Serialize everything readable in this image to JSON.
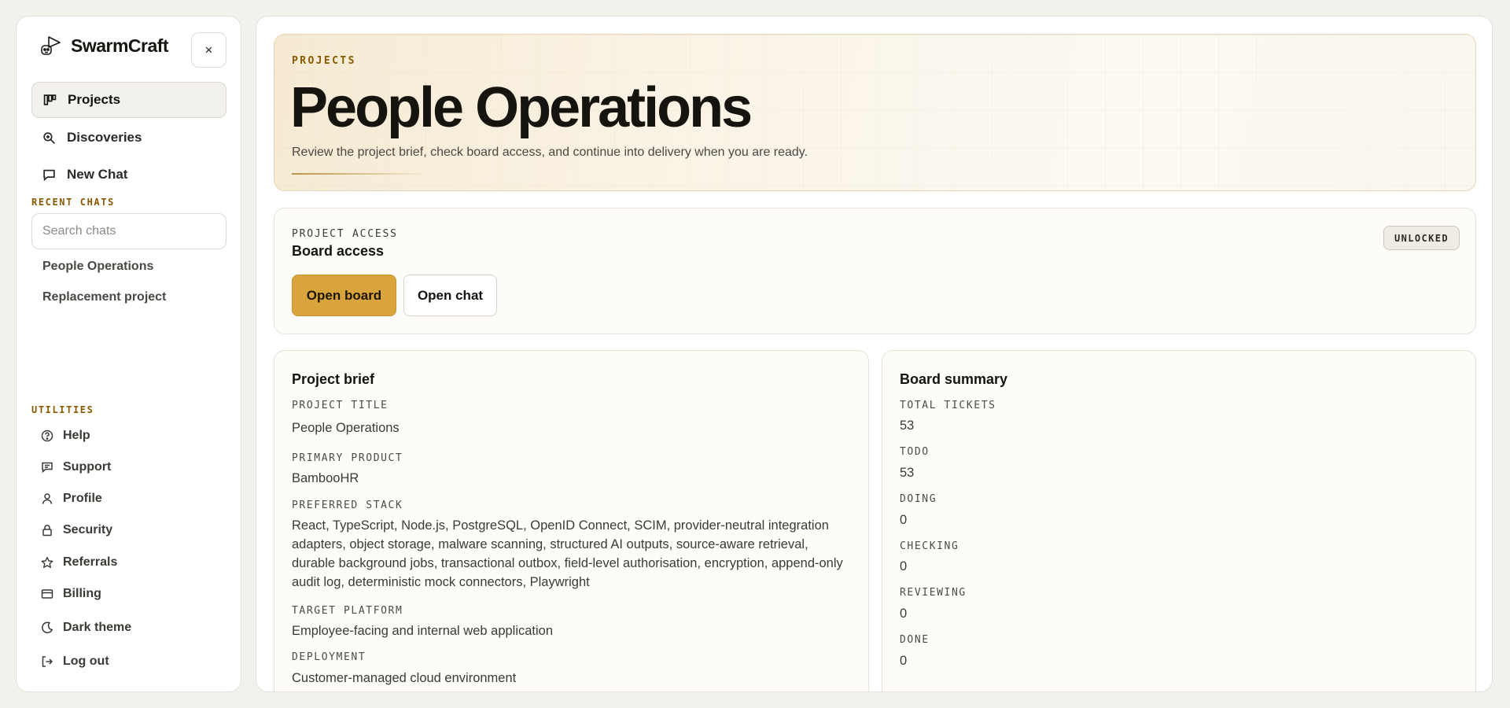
{
  "brand": {
    "name": "SwarmCraft"
  },
  "sidebar": {
    "close_label": "×",
    "nav": [
      {
        "label": "Projects",
        "icon": "kanban-icon",
        "active": true
      },
      {
        "label": "Discoveries",
        "icon": "search-zoom-icon"
      },
      {
        "label": "New Chat",
        "icon": "chat-bubble-icon"
      }
    ],
    "recent_label": "RECENT CHATS",
    "search_placeholder": "Search chats",
    "recent_chats": [
      "People Operations",
      "Replacement project"
    ],
    "utilities_label": "UTILITIES",
    "utilities": [
      {
        "label": "Help",
        "icon": "help-circle-icon"
      },
      {
        "label": "Support",
        "icon": "support-chat-icon"
      },
      {
        "label": "Profile",
        "icon": "user-icon"
      },
      {
        "label": "Security",
        "icon": "lock-icon"
      },
      {
        "label": "Referrals",
        "icon": "star-icon"
      },
      {
        "label": "Billing",
        "icon": "credit-card-icon"
      },
      {
        "label": "Dark theme",
        "icon": "moon-icon"
      },
      {
        "label": "Log out",
        "icon": "logout-icon"
      }
    ]
  },
  "hero": {
    "kicker": "PROJECTS",
    "title": "People Operations",
    "description": "Review the project brief, check board access, and continue into delivery when you are ready."
  },
  "access": {
    "kicker": "PROJECT ACCESS",
    "title": "Board access",
    "badge": "UNLOCKED",
    "primary_button": "Open board",
    "secondary_button": "Open chat"
  },
  "brief": {
    "title": "Project brief",
    "fields": [
      {
        "label": "PROJECT TITLE",
        "value": "People Operations"
      },
      {
        "label": "PRIMARY PRODUCT",
        "value": "BambooHR"
      },
      {
        "label": "PREFERRED STACK",
        "value": "React, TypeScript, Node.js, PostgreSQL, OpenID Connect, SCIM, provider-neutral integration adapters, object storage, malware scanning, structured AI outputs, source-aware retrieval, durable background jobs, transactional outbox, field-level authorisation, encryption, append-only audit log, deterministic mock connectors, Playwright"
      },
      {
        "label": "TARGET PLATFORM",
        "value": "Employee-facing and internal web application"
      },
      {
        "label": "DEPLOYMENT",
        "value": "Customer-managed cloud environment"
      }
    ]
  },
  "summary": {
    "title": "Board summary",
    "stats": [
      {
        "label": "TOTAL TICKETS",
        "value": "53"
      },
      {
        "label": "TODO",
        "value": "53"
      },
      {
        "label": "DOING",
        "value": "0"
      },
      {
        "label": "CHECKING",
        "value": "0"
      },
      {
        "label": "REVIEWING",
        "value": "0"
      },
      {
        "label": "DONE",
        "value": "0"
      }
    ]
  },
  "colors": {
    "accent": "#d9a43c",
    "kicker": "#8a5a00",
    "background": "#f2f1ec"
  }
}
